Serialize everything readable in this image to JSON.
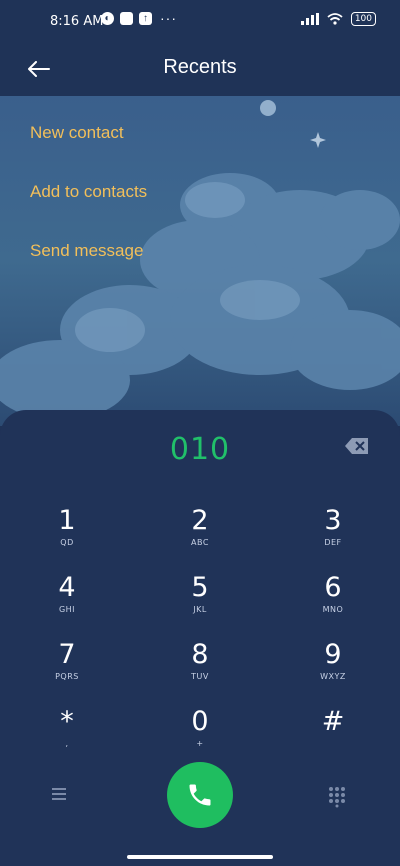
{
  "status_bar": {
    "time": "8:16 AM",
    "battery": "100"
  },
  "header": {
    "title": "Recents"
  },
  "menu": [
    "New contact",
    "Add to contacts",
    "Send message"
  ],
  "dialer": {
    "number": "010",
    "keys": [
      {
        "digit": "1",
        "letters": "QD"
      },
      {
        "digit": "2",
        "letters": "ABC"
      },
      {
        "digit": "3",
        "letters": "DEF"
      },
      {
        "digit": "4",
        "letters": "GHI"
      },
      {
        "digit": "5",
        "letters": "JKL"
      },
      {
        "digit": "6",
        "letters": "MNO"
      },
      {
        "digit": "7",
        "letters": "PQRS"
      },
      {
        "digit": "8",
        "letters": "TUV"
      },
      {
        "digit": "9",
        "letters": "WXYZ"
      },
      {
        "digit": "*",
        "letters": ","
      },
      {
        "digit": "0",
        "letters": "+"
      },
      {
        "digit": "#",
        "letters": ""
      }
    ]
  },
  "colors": {
    "accent_green": "#1fbe60",
    "menu_text": "#f2bf5a",
    "panel": "#203358"
  },
  "icons": {
    "back": "arrow-left-icon",
    "backspace": "backspace-icon",
    "menu": "hamburger-icon",
    "call": "phone-icon",
    "dialpad": "dialpad-icon"
  }
}
